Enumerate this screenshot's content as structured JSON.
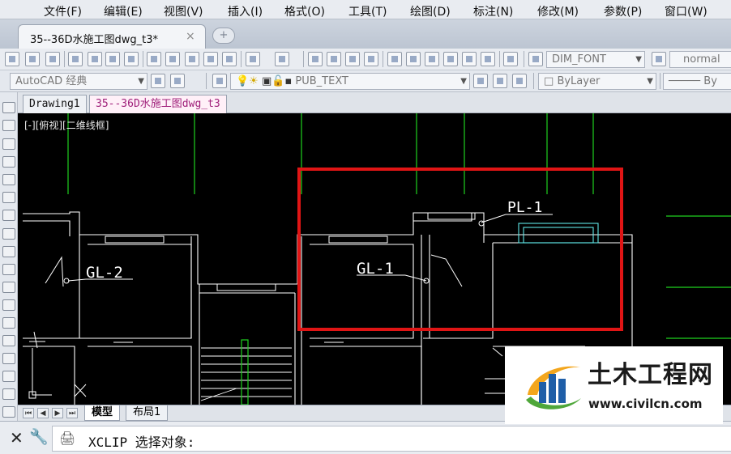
{
  "menu": [
    "文件(F)",
    "编辑(E)",
    "视图(V)",
    "插入(I)",
    "格式(O)",
    "工具(T)",
    "绘图(D)",
    "标注(N)",
    "修改(M)",
    "参数(P)",
    "窗口(W)"
  ],
  "doc_tab": {
    "title": "35--36D水施工图dwg_t3*",
    "close": "×",
    "new_tab": "+"
  },
  "toolbar": {
    "text_style": "DIM_FONT",
    "dim_style": "normal",
    "workspace": "AutoCAD 经典",
    "layer": "PUB_TEXT",
    "color": "ByLayer",
    "linetype": "By"
  },
  "drawing_tabs": [
    "Drawing1",
    "35--36D水施工图dwg_t3"
  ],
  "viewport_label": "[-][俯视][二维线框]",
  "drawing": {
    "labels": [
      "GL-2",
      "GL-1",
      "PL-1"
    ],
    "colors": {
      "background": "#000000",
      "walls": "#ffffff",
      "grid": "#1fd11f",
      "fixture": "#5fe6e6",
      "highlight": "#e01515"
    }
  },
  "layout_tabs": [
    "模型",
    "布局1"
  ],
  "command": {
    "close": "✕",
    "tool": "🔧",
    "prompt_icon": "🖨",
    "text": "XCLIP 选择对象:"
  },
  "watermark": {
    "title": "土木工程网",
    "url": "www.civilcn.com",
    "colors": {
      "blue": "#1f5fa8",
      "yellow": "#f3a61d",
      "green": "#4fa73a"
    }
  }
}
